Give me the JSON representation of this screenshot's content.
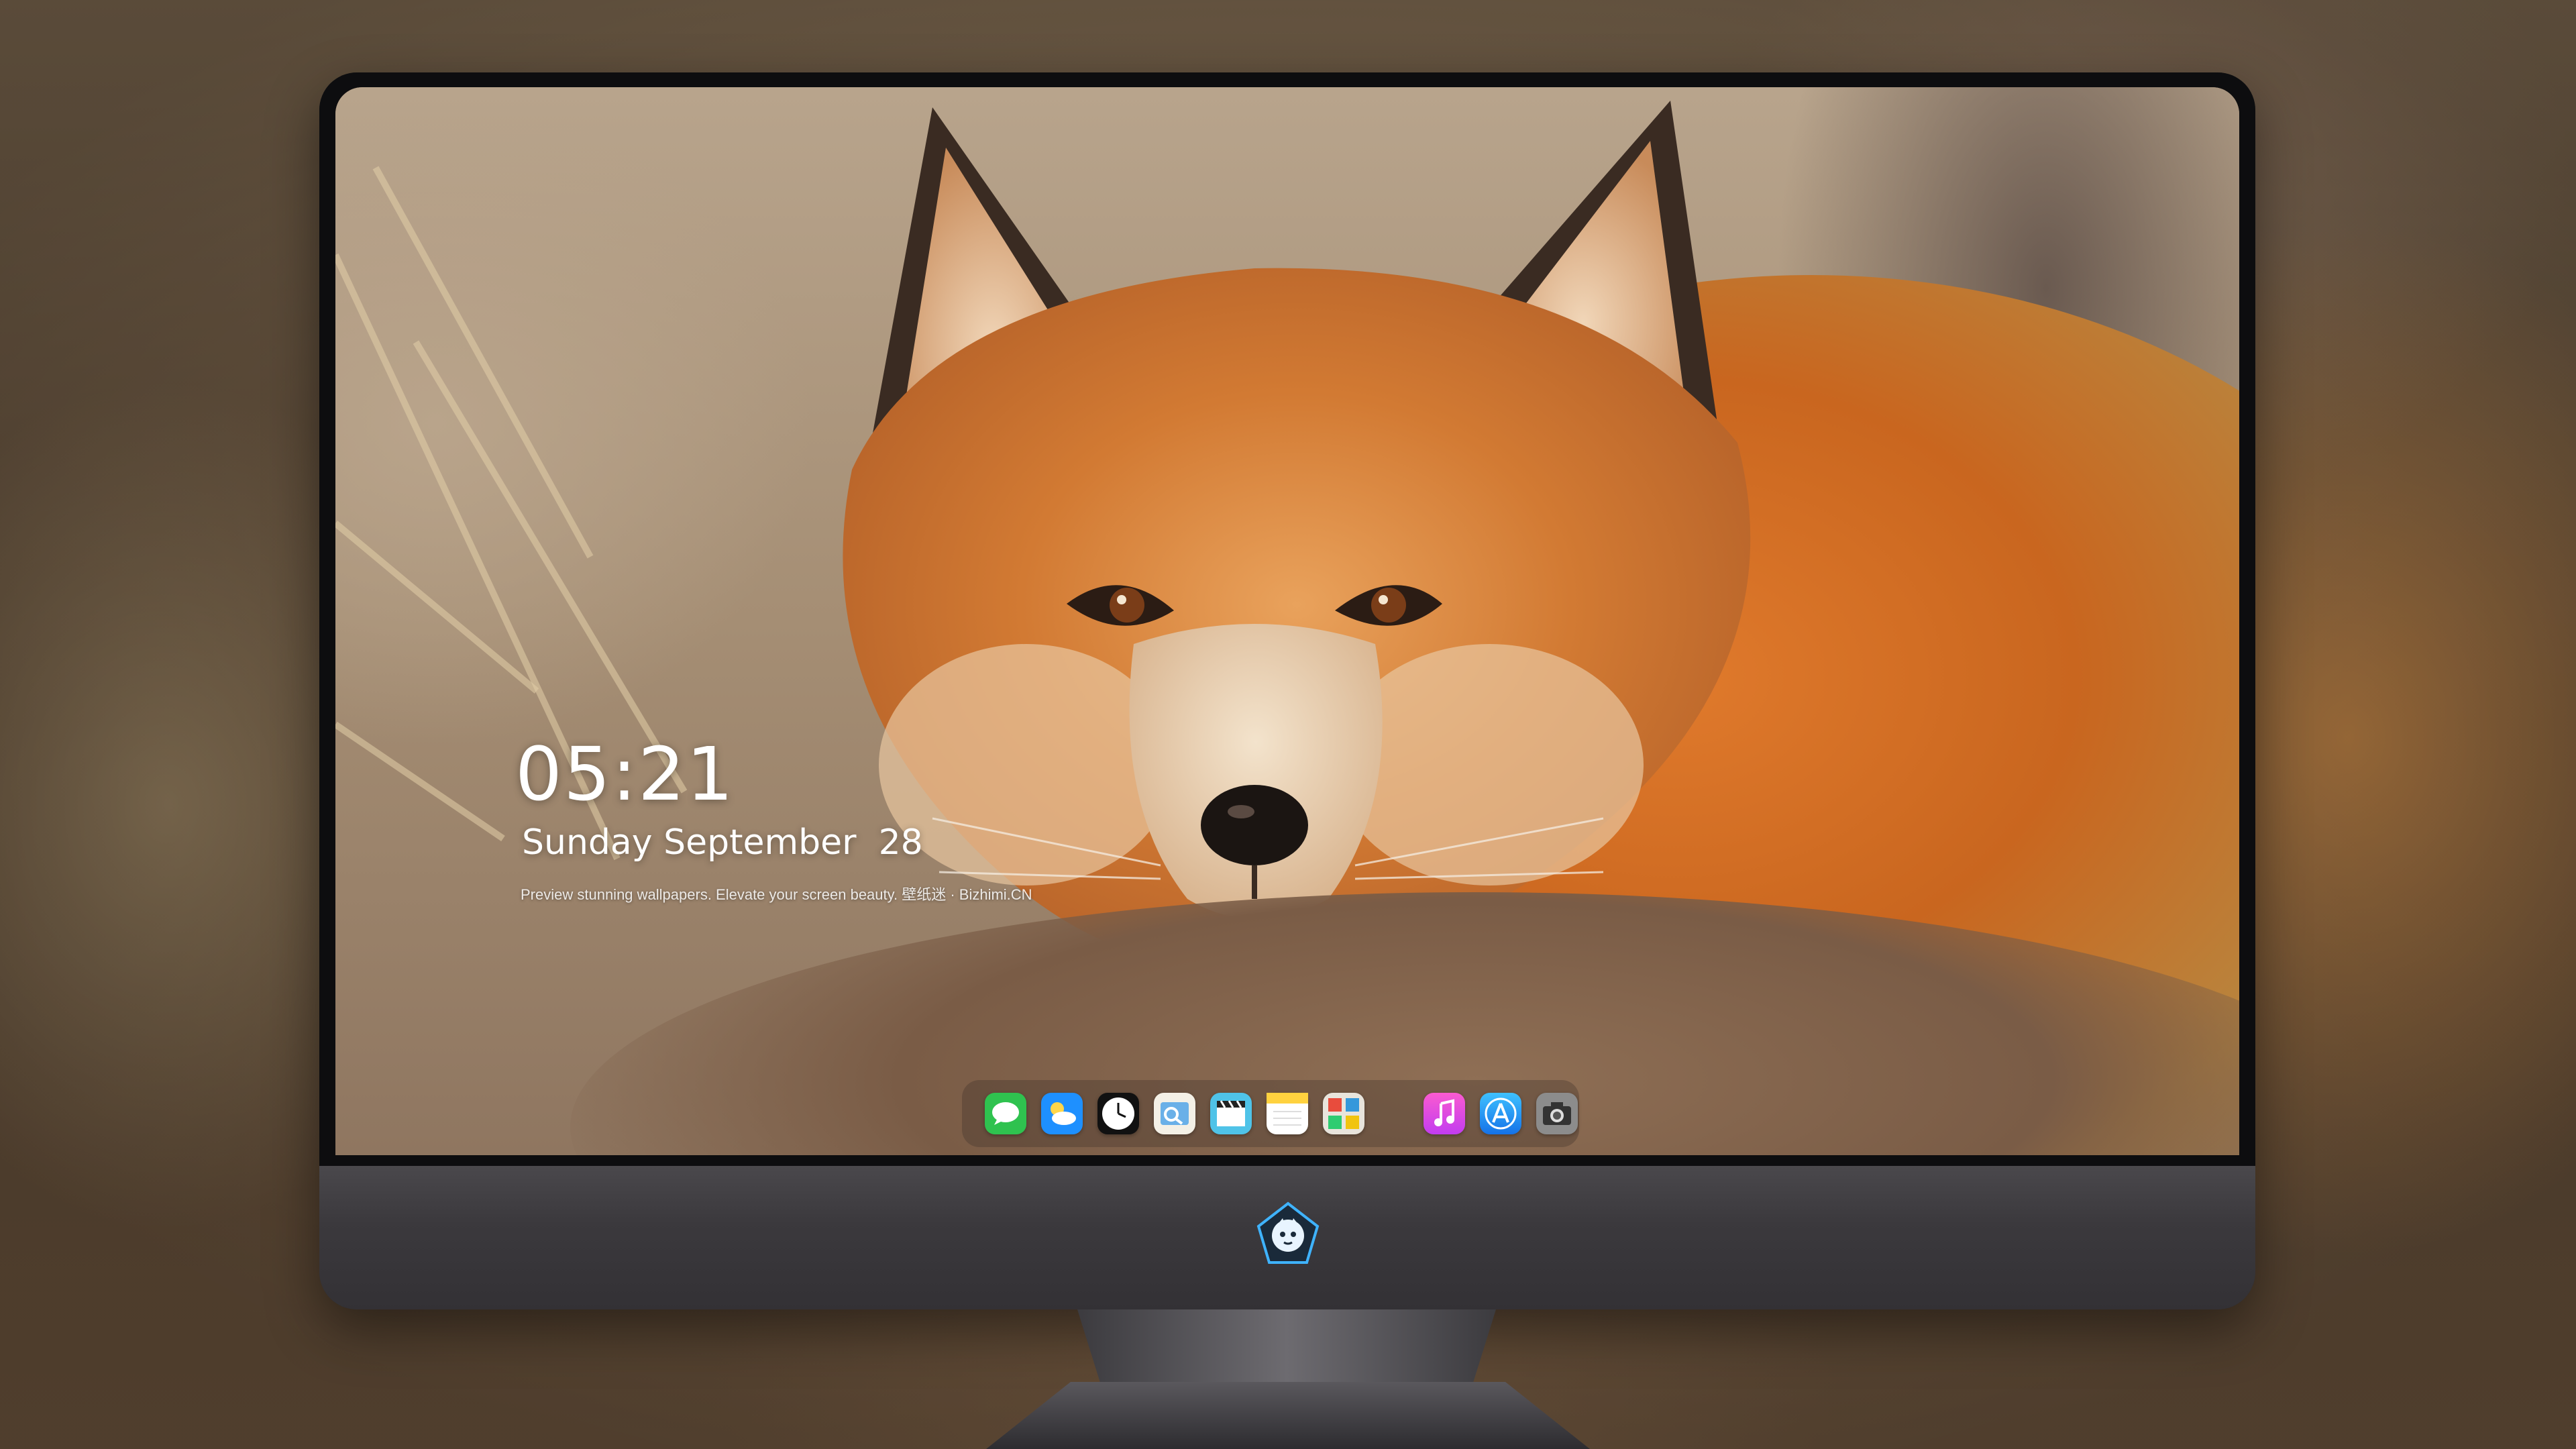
{
  "lockscreen": {
    "time": "05:21",
    "date": "Sunday September  28",
    "caption": "Preview stunning wallpapers. Elevate your screen beauty. 壁纸迷 · Bizhimi.CN"
  },
  "dock": {
    "apps": [
      {
        "icon": "messages-icon"
      },
      {
        "icon": "weather-icon"
      },
      {
        "icon": "clock-icon"
      },
      {
        "icon": "preview-icon"
      },
      {
        "icon": "clapperboard-icon"
      },
      {
        "icon": "notes-icon"
      },
      {
        "icon": "photo-booth-icon"
      },
      {
        "icon": "music-icon"
      },
      {
        "icon": "app-store-icon"
      },
      {
        "icon": "camera-icon"
      }
    ]
  },
  "colors": {
    "accent": "#1e90ff",
    "chin": "#3b393d"
  }
}
